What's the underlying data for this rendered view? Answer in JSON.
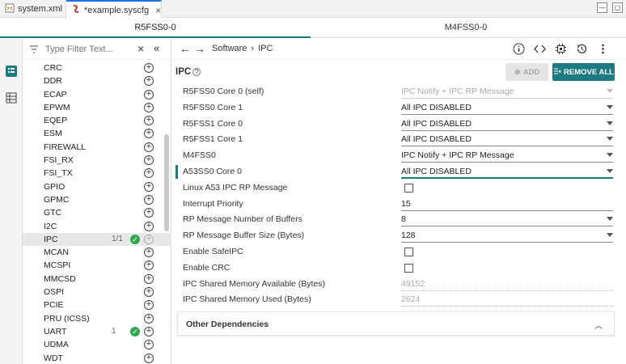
{
  "tabs": [
    {
      "label": "system.xml",
      "icon": "xml-file-icon"
    },
    {
      "label": "*example.syscfg",
      "icon": "syscfg-file-icon"
    }
  ],
  "context_tabs": [
    "R5FSS0-0",
    "M4FSS0-0"
  ],
  "filter": {
    "placeholder": "Type Filter Text..."
  },
  "modules": [
    {
      "name": "CRC"
    },
    {
      "name": "DDR"
    },
    {
      "name": "ECAP"
    },
    {
      "name": "EPWM"
    },
    {
      "name": "EQEP"
    },
    {
      "name": "ESM"
    },
    {
      "name": "FIREWALL"
    },
    {
      "name": "FSI_RX"
    },
    {
      "name": "FSI_TX"
    },
    {
      "name": "GPIO"
    },
    {
      "name": "GPMC"
    },
    {
      "name": "GTC"
    },
    {
      "name": "I2C"
    },
    {
      "name": "IPC",
      "count": "1/1",
      "checked": true,
      "selected": true
    },
    {
      "name": "MCAN"
    },
    {
      "name": "MCSPI"
    },
    {
      "name": "MMCSD"
    },
    {
      "name": "OSPI"
    },
    {
      "name": "PCIE"
    },
    {
      "name": "PRU (ICSS)"
    },
    {
      "name": "UART",
      "count": "1",
      "checked": true
    },
    {
      "name": "UDMA"
    },
    {
      "name": "WDT"
    }
  ],
  "breadcrumb": [
    "Software",
    "IPC"
  ],
  "panel": {
    "title": "IPC",
    "add_label": "ADD",
    "remove_all_label": "REMOVE ALL"
  },
  "config": [
    {
      "label": "R5FSS0 Core 0 (self)",
      "type": "select",
      "value": "IPC Notify + IPC RP Message",
      "disabled": true
    },
    {
      "label": "R5FSS0 Core 1",
      "type": "select",
      "value": "All IPC DISABLED"
    },
    {
      "label": "R5FSS1 Core 0",
      "type": "select",
      "value": "All IPC DISABLED"
    },
    {
      "label": "R5FSS1 Core 1",
      "type": "select",
      "value": "All IPC DISABLED"
    },
    {
      "label": "M4FSS0",
      "type": "select",
      "value": "IPC Notify + IPC RP Message"
    },
    {
      "label": "A53SS0 Core 0",
      "type": "select",
      "value": "All IPC DISABLED",
      "focused": true
    },
    {
      "label": "Linux A53 IPC RP Message",
      "type": "checkbox"
    },
    {
      "label": "Interrupt Priority",
      "type": "text",
      "value": "15"
    },
    {
      "label": "RP Message Number of Buffers",
      "type": "select",
      "value": "8"
    },
    {
      "label": "RP Message Buffer Size (Bytes)",
      "type": "select",
      "value": "128"
    },
    {
      "label": "Enable SafeIPC",
      "type": "checkbox"
    },
    {
      "label": "Enable CRC",
      "type": "checkbox"
    },
    {
      "label": "IPC Shared Memory Available (Bytes)",
      "type": "readonly",
      "value": "49152"
    },
    {
      "label": "IPC Shared Memory Used (Bytes)",
      "type": "readonly",
      "value": "2624"
    }
  ],
  "other_dependencies": {
    "label": "Other Dependencies"
  },
  "colors": {
    "accent": "#1d7a82",
    "check": "#2fa84f",
    "tab_active": "#1a73e8"
  }
}
